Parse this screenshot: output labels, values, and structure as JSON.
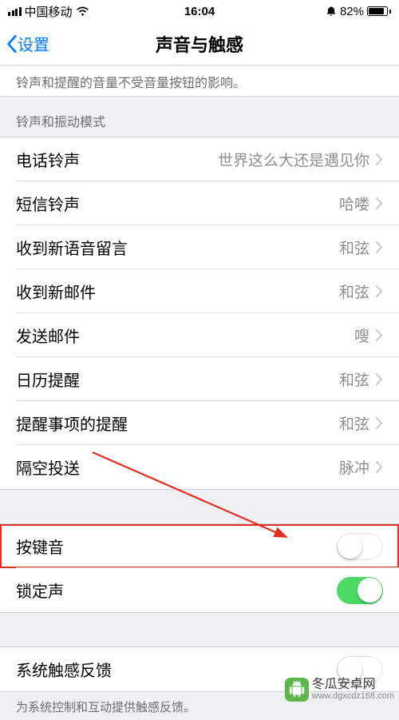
{
  "status": {
    "carrier": "中国移动",
    "time": "16:04",
    "battery_pct": "82%"
  },
  "nav": {
    "back": "设置",
    "title": "声音与触感"
  },
  "helper_top": "铃声和提醒的音量不受音量按钮的影响。",
  "section_ringtones": "铃声和振动模式",
  "rows": {
    "ringtone": {
      "label": "电话铃声",
      "value": "世界这么大还是遇见你"
    },
    "text_tone": {
      "label": "短信铃声",
      "value": "哈喽"
    },
    "voicemail": {
      "label": "收到新语音留言",
      "value": "和弦"
    },
    "new_mail": {
      "label": "收到新邮件",
      "value": "和弦"
    },
    "sent_mail": {
      "label": "发送邮件",
      "value": "嗖"
    },
    "calendar": {
      "label": "日历提醒",
      "value": "和弦"
    },
    "reminders": {
      "label": "提醒事项的提醒",
      "value": "和弦"
    },
    "airdrop": {
      "label": "隔空投送",
      "value": "脉冲"
    }
  },
  "switches": {
    "keyboard_clicks": {
      "label": "按键音",
      "on": false
    },
    "lock_sound": {
      "label": "锁定声",
      "on": true
    }
  },
  "haptics": {
    "label": "系统触感反馈",
    "on": false,
    "footer": "为系统控制和互动提供触感反馈。"
  },
  "watermark": {
    "title": "冬瓜安卓网",
    "url": "www.dgxcdz168.com"
  }
}
